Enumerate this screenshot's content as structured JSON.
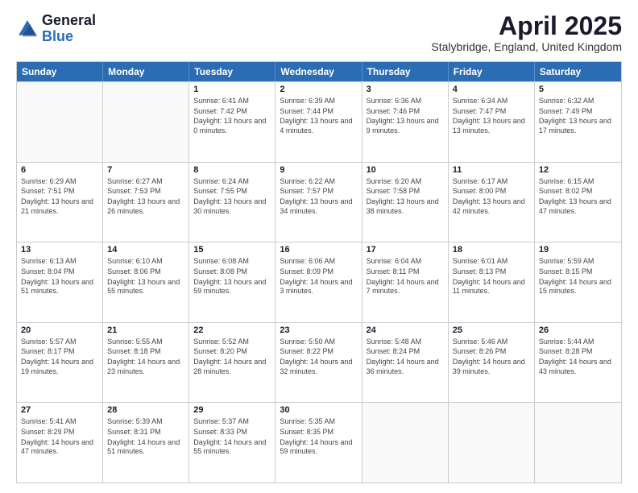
{
  "header": {
    "logo": {
      "general": "General",
      "blue": "Blue"
    },
    "title": "April 2025",
    "location": "Stalybridge, England, United Kingdom"
  },
  "calendar": {
    "days": [
      "Sunday",
      "Monday",
      "Tuesday",
      "Wednesday",
      "Thursday",
      "Friday",
      "Saturday"
    ],
    "rows": [
      [
        {
          "day": null
        },
        {
          "day": null
        },
        {
          "day": "1",
          "sunrise": "Sunrise: 6:41 AM",
          "sunset": "Sunset: 7:42 PM",
          "daylight": "Daylight: 13 hours and 0 minutes."
        },
        {
          "day": "2",
          "sunrise": "Sunrise: 6:39 AM",
          "sunset": "Sunset: 7:44 PM",
          "daylight": "Daylight: 13 hours and 4 minutes."
        },
        {
          "day": "3",
          "sunrise": "Sunrise: 6:36 AM",
          "sunset": "Sunset: 7:46 PM",
          "daylight": "Daylight: 13 hours and 9 minutes."
        },
        {
          "day": "4",
          "sunrise": "Sunrise: 6:34 AM",
          "sunset": "Sunset: 7:47 PM",
          "daylight": "Daylight: 13 hours and 13 minutes."
        },
        {
          "day": "5",
          "sunrise": "Sunrise: 6:32 AM",
          "sunset": "Sunset: 7:49 PM",
          "daylight": "Daylight: 13 hours and 17 minutes."
        }
      ],
      [
        {
          "day": "6",
          "sunrise": "Sunrise: 6:29 AM",
          "sunset": "Sunset: 7:51 PM",
          "daylight": "Daylight: 13 hours and 21 minutes."
        },
        {
          "day": "7",
          "sunrise": "Sunrise: 6:27 AM",
          "sunset": "Sunset: 7:53 PM",
          "daylight": "Daylight: 13 hours and 26 minutes."
        },
        {
          "day": "8",
          "sunrise": "Sunrise: 6:24 AM",
          "sunset": "Sunset: 7:55 PM",
          "daylight": "Daylight: 13 hours and 30 minutes."
        },
        {
          "day": "9",
          "sunrise": "Sunrise: 6:22 AM",
          "sunset": "Sunset: 7:57 PM",
          "daylight": "Daylight: 13 hours and 34 minutes."
        },
        {
          "day": "10",
          "sunrise": "Sunrise: 6:20 AM",
          "sunset": "Sunset: 7:58 PM",
          "daylight": "Daylight: 13 hours and 38 minutes."
        },
        {
          "day": "11",
          "sunrise": "Sunrise: 6:17 AM",
          "sunset": "Sunset: 8:00 PM",
          "daylight": "Daylight: 13 hours and 42 minutes."
        },
        {
          "day": "12",
          "sunrise": "Sunrise: 6:15 AM",
          "sunset": "Sunset: 8:02 PM",
          "daylight": "Daylight: 13 hours and 47 minutes."
        }
      ],
      [
        {
          "day": "13",
          "sunrise": "Sunrise: 6:13 AM",
          "sunset": "Sunset: 8:04 PM",
          "daylight": "Daylight: 13 hours and 51 minutes."
        },
        {
          "day": "14",
          "sunrise": "Sunrise: 6:10 AM",
          "sunset": "Sunset: 8:06 PM",
          "daylight": "Daylight: 13 hours and 55 minutes."
        },
        {
          "day": "15",
          "sunrise": "Sunrise: 6:08 AM",
          "sunset": "Sunset: 8:08 PM",
          "daylight": "Daylight: 13 hours and 59 minutes."
        },
        {
          "day": "16",
          "sunrise": "Sunrise: 6:06 AM",
          "sunset": "Sunset: 8:09 PM",
          "daylight": "Daylight: 14 hours and 3 minutes."
        },
        {
          "day": "17",
          "sunrise": "Sunrise: 6:04 AM",
          "sunset": "Sunset: 8:11 PM",
          "daylight": "Daylight: 14 hours and 7 minutes."
        },
        {
          "day": "18",
          "sunrise": "Sunrise: 6:01 AM",
          "sunset": "Sunset: 8:13 PM",
          "daylight": "Daylight: 14 hours and 11 minutes."
        },
        {
          "day": "19",
          "sunrise": "Sunrise: 5:59 AM",
          "sunset": "Sunset: 8:15 PM",
          "daylight": "Daylight: 14 hours and 15 minutes."
        }
      ],
      [
        {
          "day": "20",
          "sunrise": "Sunrise: 5:57 AM",
          "sunset": "Sunset: 8:17 PM",
          "daylight": "Daylight: 14 hours and 19 minutes."
        },
        {
          "day": "21",
          "sunrise": "Sunrise: 5:55 AM",
          "sunset": "Sunset: 8:18 PM",
          "daylight": "Daylight: 14 hours and 23 minutes."
        },
        {
          "day": "22",
          "sunrise": "Sunrise: 5:52 AM",
          "sunset": "Sunset: 8:20 PM",
          "daylight": "Daylight: 14 hours and 28 minutes."
        },
        {
          "day": "23",
          "sunrise": "Sunrise: 5:50 AM",
          "sunset": "Sunset: 8:22 PM",
          "daylight": "Daylight: 14 hours and 32 minutes."
        },
        {
          "day": "24",
          "sunrise": "Sunrise: 5:48 AM",
          "sunset": "Sunset: 8:24 PM",
          "daylight": "Daylight: 14 hours and 36 minutes."
        },
        {
          "day": "25",
          "sunrise": "Sunrise: 5:46 AM",
          "sunset": "Sunset: 8:26 PM",
          "daylight": "Daylight: 14 hours and 39 minutes."
        },
        {
          "day": "26",
          "sunrise": "Sunrise: 5:44 AM",
          "sunset": "Sunset: 8:28 PM",
          "daylight": "Daylight: 14 hours and 43 minutes."
        }
      ],
      [
        {
          "day": "27",
          "sunrise": "Sunrise: 5:41 AM",
          "sunset": "Sunset: 8:29 PM",
          "daylight": "Daylight: 14 hours and 47 minutes."
        },
        {
          "day": "28",
          "sunrise": "Sunrise: 5:39 AM",
          "sunset": "Sunset: 8:31 PM",
          "daylight": "Daylight: 14 hours and 51 minutes."
        },
        {
          "day": "29",
          "sunrise": "Sunrise: 5:37 AM",
          "sunset": "Sunset: 8:33 PM",
          "daylight": "Daylight: 14 hours and 55 minutes."
        },
        {
          "day": "30",
          "sunrise": "Sunrise: 5:35 AM",
          "sunset": "Sunset: 8:35 PM",
          "daylight": "Daylight: 14 hours and 59 minutes."
        },
        {
          "day": null
        },
        {
          "day": null
        },
        {
          "day": null
        }
      ]
    ]
  }
}
